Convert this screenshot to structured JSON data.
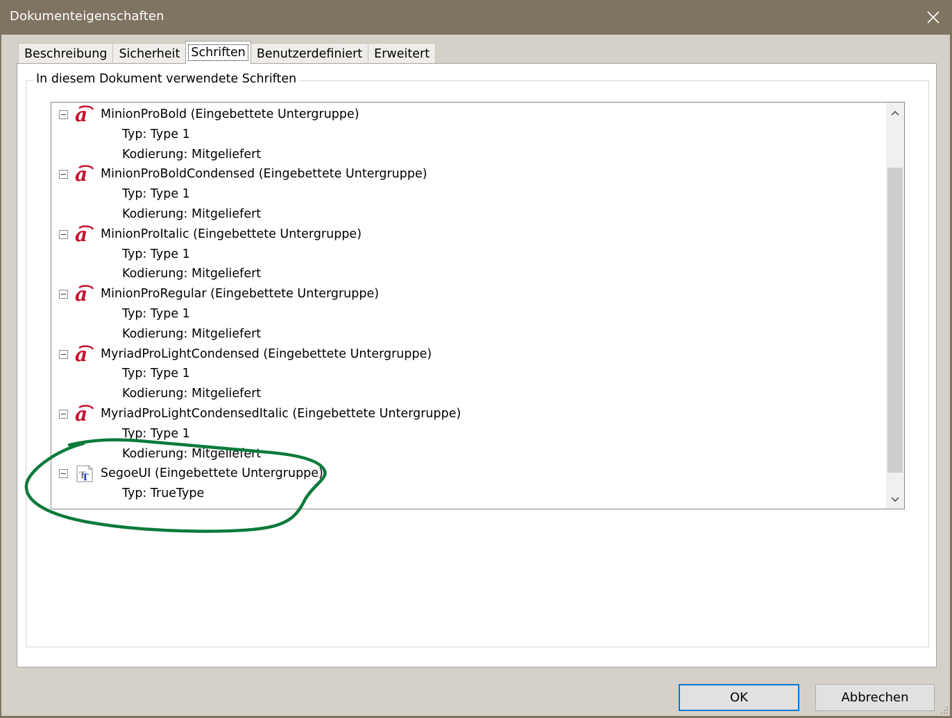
{
  "window": {
    "title": "Dokumenteigenschaften",
    "close_icon": "close-icon"
  },
  "tabs": [
    {
      "label": "Beschreibung",
      "active": false
    },
    {
      "label": "Sicherheit",
      "active": false
    },
    {
      "label": "Schriften",
      "active": true
    },
    {
      "label": "Benutzerdefiniert",
      "active": false
    },
    {
      "label": "Erweitert",
      "active": false
    }
  ],
  "fonts_group": {
    "label": "In diesem Dokument verwendete Schriften",
    "fonts": [
      {
        "name": "MinionProBold (Eingebettete Untergruppe)",
        "icon": "type1-font-icon",
        "type": "Typ: Type 1",
        "encoding": "Kodierung: Mitgeliefert"
      },
      {
        "name": "MinionProBoldCondensed (Eingebettete Untergruppe)",
        "icon": "type1-font-icon",
        "type": "Typ: Type 1",
        "encoding": "Kodierung: Mitgeliefert"
      },
      {
        "name": "MinionProItalic (Eingebettete Untergruppe)",
        "icon": "type1-font-icon",
        "type": "Typ: Type 1",
        "encoding": "Kodierung: Mitgeliefert"
      },
      {
        "name": "MinionProRegular (Eingebettete Untergruppe)",
        "icon": "type1-font-icon",
        "type": "Typ: Type 1",
        "encoding": "Kodierung: Mitgeliefert"
      },
      {
        "name": "MyriadProLightCondensed (Eingebettete Untergruppe)",
        "icon": "type1-font-icon",
        "type": "Typ: Type 1",
        "encoding": "Kodierung: Mitgeliefert"
      },
      {
        "name": "MyriadProLightCondensedItalic (Eingebettete Untergruppe)",
        "icon": "type1-font-icon",
        "type": "Typ: Type 1",
        "encoding": "Kodierung: Mitgeliefert"
      },
      {
        "name": "SegoeUI (Eingebettete Untergruppe)",
        "icon": "truetype-font-icon",
        "type": "Typ: TrueType",
        "encoding": null
      }
    ]
  },
  "colors": {
    "titlebar": "#7f7461",
    "type1_icon": "#c8102e",
    "truetype_icon": "#1a3fc4",
    "annotation": "#0b7a3b",
    "primary_border": "#0078d7"
  },
  "buttons": {
    "ok_label": "OK",
    "cancel_label": "Abbrechen"
  }
}
